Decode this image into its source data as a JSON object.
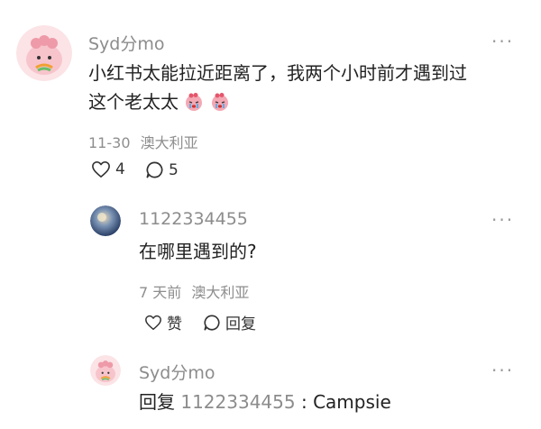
{
  "more_glyph": "···",
  "main_comment": {
    "user": "Syd分mo",
    "line1": "小红书太能拉近距离了，我两个小时前才遇到过",
    "line2": "这个老太太",
    "emoji_name": "crying-face-sticker",
    "date": "11-30",
    "location": "澳大利亚",
    "likes": "4",
    "comments": "5"
  },
  "reply1": {
    "user": "1122334455",
    "text": "在哪里遇到的?",
    "date": "7 天前",
    "location": "澳大利亚",
    "like_label": "赞",
    "reply_label": "回复"
  },
  "reply2": {
    "user": "Syd分mo",
    "prefix": "回复",
    "target": "1122334455",
    "separator": " : ",
    "text": "Campsie"
  },
  "colors": {
    "meta": "#8e8e8e",
    "avatar_pink": "#f7c4cc",
    "avatar_blue": "#3a5a86"
  }
}
